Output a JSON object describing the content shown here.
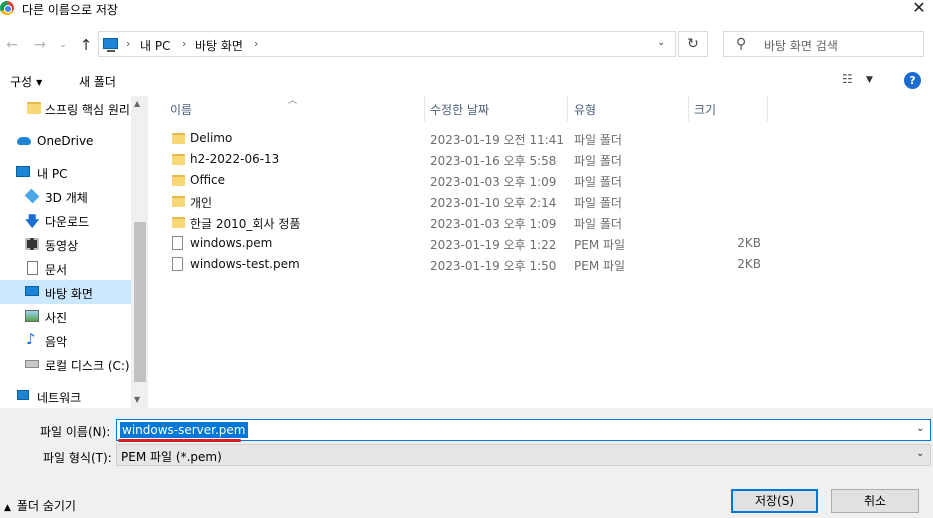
{
  "window": {
    "title": "다른 이름으로 저장",
    "close": "✕"
  },
  "nav_buttons": {
    "back": "←",
    "forward": "→",
    "recent": "⌄",
    "up": "↑"
  },
  "address": {
    "crumbs": [
      "내 PC",
      "바탕 화면"
    ],
    "dropdown": "⌄",
    "refresh": "↻"
  },
  "search": {
    "placeholder": "바탕 화면 검색"
  },
  "toolbar": {
    "organize": "구성",
    "new_folder": "새 폴더",
    "view": "☷",
    "help": "?"
  },
  "sidebar": {
    "items": [
      {
        "label": "스프링 핵심 원리",
        "icon": "folder-icon"
      },
      {
        "label": "OneDrive",
        "icon": "cloud-icon"
      },
      {
        "label": "내 PC",
        "icon": "pc-icon"
      },
      {
        "label": "3D 개체",
        "icon": "cube-icon"
      },
      {
        "label": "다운로드",
        "icon": "download-icon"
      },
      {
        "label": "동영상",
        "icon": "video-icon"
      },
      {
        "label": "문서",
        "icon": "document-icon"
      },
      {
        "label": "바탕 화면",
        "icon": "desktop-icon",
        "selected": true
      },
      {
        "label": "사진",
        "icon": "pictures-icon"
      },
      {
        "label": "음악",
        "icon": "music-icon"
      },
      {
        "label": "로컬 디스크 (C:)",
        "icon": "drive-icon"
      },
      {
        "label": "네트워크",
        "icon": "network-icon"
      }
    ]
  },
  "columns": {
    "name": "이름",
    "modified": "수정한 날짜",
    "type": "유형",
    "size": "크기"
  },
  "files": [
    {
      "name": "Delimo",
      "modified": "2023-01-19 오전 11:41",
      "type": "파일 폴더",
      "size": "",
      "kind": "folder"
    },
    {
      "name": "h2-2022-06-13",
      "modified": "2023-01-16 오후 5:58",
      "type": "파일 폴더",
      "size": "",
      "kind": "folder"
    },
    {
      "name": "Office",
      "modified": "2023-01-03 오후 1:09",
      "type": "파일 폴더",
      "size": "",
      "kind": "folder"
    },
    {
      "name": "개인",
      "modified": "2023-01-10 오후 2:14",
      "type": "파일 폴더",
      "size": "",
      "kind": "folder"
    },
    {
      "name": "한글 2010_회사 정품",
      "modified": "2023-01-03 오후 1:09",
      "type": "파일 폴더",
      "size": "",
      "kind": "folder"
    },
    {
      "name": "windows.pem",
      "modified": "2023-01-19 오후 1:22",
      "type": "PEM 파일",
      "size": "2KB",
      "kind": "file"
    },
    {
      "name": "windows-test.pem",
      "modified": "2023-01-19 오후 1:50",
      "type": "PEM 파일",
      "size": "2KB",
      "kind": "file"
    }
  ],
  "form": {
    "filename_label": "파일 이름(N):",
    "filename_value": "windows-server.pem",
    "filetype_label": "파일 형식(T):",
    "filetype_value": "PEM 파일 (*.pem)"
  },
  "footer": {
    "hide_folders": "폴더 숨기기",
    "save": "저장(S)",
    "cancel": "취소"
  },
  "colors": {
    "accent": "#0078d7",
    "selection": "#cce8ff",
    "annotation": "#d21e1e"
  }
}
